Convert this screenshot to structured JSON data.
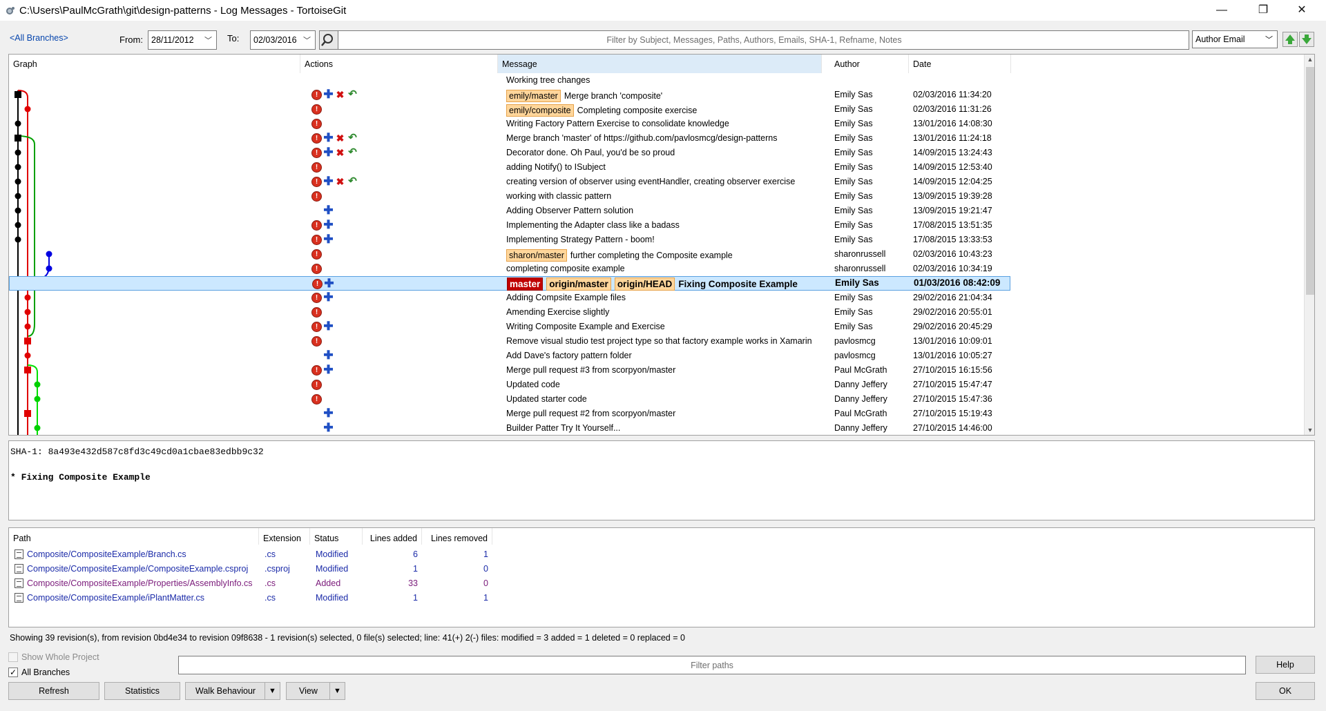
{
  "window": {
    "title": "C:\\Users\\PaulMcGrath\\git\\design-patterns - Log Messages - TortoiseGit",
    "buttons": {
      "minimize": "—",
      "restore": "❐",
      "close": "✕"
    }
  },
  "toolbar": {
    "branch_link": "<All Branches>",
    "from_label": "From:",
    "from_value": "28/11/2012",
    "to_label": "To:",
    "to_value": "02/03/2016",
    "filter_placeholder": "Filter by Subject, Messages, Paths, Authors, Emails, SHA-1, Refname, Notes",
    "filter_field": "Author Email"
  },
  "log": {
    "columns": {
      "graph": "Graph",
      "actions": "Actions",
      "message": "Message",
      "author": "Author",
      "date": "Date"
    },
    "rows": [
      {
        "message": "Working tree changes",
        "tags": [],
        "author": "",
        "date": "",
        "actions": []
      },
      {
        "message": "Merge branch 'composite'",
        "tags": [
          "emily/master"
        ],
        "author": "Emily Sas",
        "date": "02/03/2016 11:34:20",
        "actions": [
          "err",
          "add",
          "del",
          "ren"
        ]
      },
      {
        "message": "Completing composite exercise",
        "tags": [
          "emily/composite"
        ],
        "author": "Emily Sas",
        "date": "02/03/2016 11:31:26",
        "actions": [
          "err"
        ]
      },
      {
        "message": "Writing Factory Pattern Exercise to consolidate knowledge",
        "tags": [],
        "author": "Emily Sas",
        "date": "13/01/2016 14:08:30",
        "actions": [
          "err"
        ]
      },
      {
        "message": "Merge branch 'master' of https://github.com/pavlosmcg/design-patterns",
        "tags": [],
        "author": "Emily Sas",
        "date": "13/01/2016 11:24:18",
        "actions": [
          "err",
          "add",
          "del",
          "ren"
        ]
      },
      {
        "message": "Decorator done. Oh Paul, you'd be so proud",
        "tags": [],
        "author": "Emily Sas",
        "date": "14/09/2015 13:24:43",
        "actions": [
          "err",
          "add",
          "del",
          "ren"
        ]
      },
      {
        "message": "adding Notify() to ISubject",
        "tags": [],
        "author": "Emily Sas",
        "date": "14/09/2015 12:53:40",
        "actions": [
          "err"
        ]
      },
      {
        "message": "creating version of observer using eventHandler, creating observer exercise",
        "tags": [],
        "author": "Emily Sas",
        "date": "14/09/2015 12:04:25",
        "actions": [
          "err",
          "add",
          "del",
          "ren"
        ]
      },
      {
        "message": "working with classic pattern",
        "tags": [],
        "author": "Emily Sas",
        "date": "13/09/2015 19:39:28",
        "actions": [
          "err"
        ]
      },
      {
        "message": "Adding Observer Pattern solution",
        "tags": [],
        "author": "Emily Sas",
        "date": "13/09/2015 19:21:47",
        "actions": [
          "add"
        ]
      },
      {
        "message": "Implementing the Adapter class like a badass",
        "tags": [],
        "author": "Emily Sas",
        "date": "17/08/2015 13:51:35",
        "actions": [
          "err",
          "add"
        ]
      },
      {
        "message": "Implementing Strategy Pattern - boom!",
        "tags": [],
        "author": "Emily Sas",
        "date": "17/08/2015 13:33:53",
        "actions": [
          "err",
          "add"
        ]
      },
      {
        "message": "further completing the Composite example",
        "tags": [
          "sharon/master"
        ],
        "author": "sharonrussell",
        "date": "02/03/2016 10:43:23",
        "actions": [
          "err"
        ]
      },
      {
        "message": "completing composite example",
        "tags": [],
        "author": "sharonrussell",
        "date": "02/03/2016 10:34:19",
        "actions": [
          "err"
        ]
      },
      {
        "message": "Fixing Composite Example",
        "tags": [
          "master",
          "origin/master",
          "origin/HEAD"
        ],
        "author": "Emily Sas",
        "date": "01/03/2016 08:42:09",
        "actions": [
          "err",
          "add"
        ],
        "selected": true
      },
      {
        "message": "Adding Compsite Example files",
        "tags": [],
        "author": "Emily Sas",
        "date": "29/02/2016 21:04:34",
        "actions": [
          "err",
          "add"
        ]
      },
      {
        "message": "Amending Exercise slightly",
        "tags": [],
        "author": "Emily Sas",
        "date": "29/02/2016 20:55:01",
        "actions": [
          "err"
        ]
      },
      {
        "message": "Writing Composite Example and Exercise",
        "tags": [],
        "author": "Emily Sas",
        "date": "29/02/2016 20:45:29",
        "actions": [
          "err",
          "add"
        ]
      },
      {
        "message": "Remove visual studio test project type so that factory example works in Xamarin",
        "tags": [],
        "author": "pavlosmcg",
        "date": "13/01/2016 10:09:01",
        "actions": [
          "err"
        ]
      },
      {
        "message": "Add Dave's factory pattern folder",
        "tags": [],
        "author": "pavlosmcg",
        "date": "13/01/2016 10:05:27",
        "actions": [
          "add"
        ]
      },
      {
        "message": "Merge pull request #3 from scorpyon/master",
        "tags": [],
        "author": "Paul McGrath",
        "date": "27/10/2015 16:15:56",
        "actions": [
          "err",
          "add"
        ]
      },
      {
        "message": "Updated code",
        "tags": [],
        "author": "Danny Jeffery",
        "date": "27/10/2015 15:47:47",
        "actions": [
          "err"
        ]
      },
      {
        "message": "Updated starter code",
        "tags": [],
        "author": "Danny Jeffery",
        "date": "27/10/2015 15:47:36",
        "actions": [
          "err"
        ]
      },
      {
        "message": "Merge pull request #2 from scorpyon/master",
        "tags": [],
        "author": "Paul McGrath",
        "date": "27/10/2015 15:19:43",
        "actions": [
          "add"
        ]
      },
      {
        "message": "Builder Patter Try It Yourself...",
        "tags": [],
        "author": "Danny Jeffery",
        "date": "27/10/2015 14:46:00",
        "actions": [
          "add"
        ]
      }
    ]
  },
  "detail": {
    "sha": "SHA-1: 8a493e432d587c8fd3c49cd0a1cbae83edbb9c32",
    "message": "* Fixing Composite Example"
  },
  "files": {
    "columns": {
      "path": "Path",
      "extension": "Extension",
      "status": "Status",
      "added": "Lines added",
      "removed": "Lines removed"
    },
    "rows": [
      {
        "path": "Composite/CompositeExample/Branch.cs",
        "extension": ".cs",
        "status": "Modified",
        "added": "6",
        "removed": "1",
        "color": "#1a2aa8"
      },
      {
        "path": "Composite/CompositeExample/CompositeExample.csproj",
        "extension": ".csproj",
        "status": "Modified",
        "added": "1",
        "removed": "0",
        "color": "#1a2aa8"
      },
      {
        "path": "Composite/CompositeExample/Properties/AssemblyInfo.cs",
        "extension": ".cs",
        "status": "Added",
        "added": "33",
        "removed": "0",
        "color": "#7a1a7a"
      },
      {
        "path": "Composite/CompositeExample/iPlantMatter.cs",
        "extension": ".cs",
        "status": "Modified",
        "added": "1",
        "removed": "1",
        "color": "#1a2aa8"
      }
    ]
  },
  "footer": {
    "status": "Showing 39 revision(s), from revision 0bd4e34 to revision 09f8638 - 1 revision(s) selected, 0 file(s) selected; line: 41(+) 2(-) files: modified = 3 added = 1 deleted = 0 replaced = 0",
    "show_whole_project": "Show Whole Project",
    "all_branches": "All Branches",
    "filter_paths_placeholder": "Filter paths",
    "buttons": {
      "help": "Help",
      "refresh": "Refresh",
      "statistics": "Statistics",
      "walk": "Walk Behaviour",
      "view": "View",
      "ok": "OK"
    }
  },
  "colors": {
    "accent": "#0645ad",
    "selection": "#cce8ff",
    "tag": "#ffd69b",
    "local_branch": "#c00000"
  }
}
